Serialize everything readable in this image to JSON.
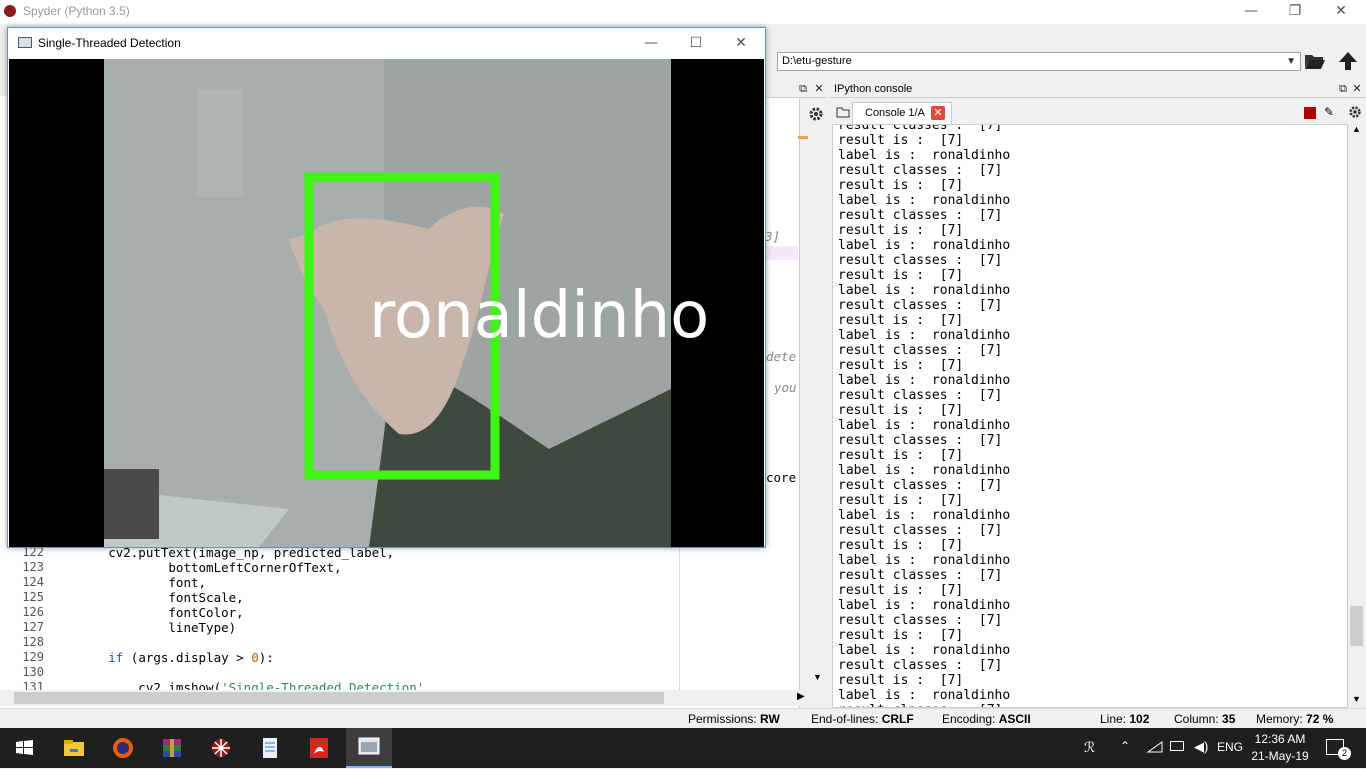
{
  "spyder": {
    "title": "Spyder (Python 3.5)",
    "minimize": "—",
    "restore": "❐",
    "close": "✕"
  },
  "toolbar": {
    "path": "D:\\etu-gesture"
  },
  "console": {
    "header": "IPython console",
    "tab_label": "Console 1/A",
    "lines": [
      "result is :  [7]",
      "label is :  ronaldinho",
      "result classes :  [7]",
      "result is :  [7]",
      "label is :  ronaldinho",
      "result classes :  [7]",
      "result is :  [7]",
      "label is :  ronaldinho",
      "result classes :  [7]",
      "result is :  [7]",
      "label is :  ronaldinho",
      "result classes :  [7]",
      "result is :  [7]",
      "label is :  ronaldinho",
      "result classes :  [7]",
      "result is :  [7]",
      "label is :  ronaldinho",
      "result classes :  [7]",
      "result is :  [7]",
      "label is :  ronaldinho",
      "result classes :  [7]",
      "result is :  [7]",
      "label is :  ronaldinho",
      "result classes :  [7]",
      "result is :  [7]",
      "label is :  ronaldinho",
      "result classes :  [7]",
      "result is :  [7]",
      "label is :  ronaldinho",
      "result classes :  [7]",
      "result is :  [7]",
      "label is :  ronaldinho",
      "result classes :  [7]",
      "result is :  [7]",
      "label is :  ronaldinho",
      "result classes :  [7]",
      "result is :  [7]",
      "label is :  ronaldinho",
      "result classes :  [7]",
      "result is :  [7]",
      "label is :  ronaldinho",
      "result classes :  [7]",
      "result is :  [7]",
      "label is :  ronaldinho",
      "result classes :  [7]",
      "result is :  [7]",
      "label is :  ronaldinho",
      "result classes :  [7]",
      "result is :  [7]",
      "label is :  ronaldinho",
      "result classes :  [7]",
      "result is :  [7]",
      "label is :  ronaldinho",
      "result classes :  [7]",
      "result is :  [7]",
      "label is :  ronaldinho",
      "result classes :  [7]",
      "result is :  [7]",
      "label is :  ronaldinho",
      "result classes :  [7]",
      "result is :  [7]",
      "label is :  ronaldinho",
      "result classes :  [7]",
      "result is :  [7]",
      "label is :  ronaldinho",
      "result classes :  [7]",
      "result is :  [7]",
      "label is :  ronaldinho",
      "result classes :  [7]",
      "result is :  [7]",
      "label is :  ronaldinho",
      "result classes :  [7]",
      "result is :  [7]",
      "label is :  ronaldinho",
      "result classes :  [7]"
    ]
  },
  "editor": {
    "fragments": {
      "f1": "3]",
      "f2": "dete",
      "f3": "you",
      "f4": "core"
    },
    "lines": [
      {
        "no": "122",
        "code": "        cv2.putText(image_np, predicted_label,"
      },
      {
        "no": "123",
        "code": "                bottomLeftCornerOfText,"
      },
      {
        "no": "124",
        "code": "                font,"
      },
      {
        "no": "125",
        "code": "                fontScale,"
      },
      {
        "no": "126",
        "code": "                fontColor,"
      },
      {
        "no": "127",
        "code": "                lineType)"
      },
      {
        "no": "128",
        "code": ""
      },
      {
        "no": "129",
        "code_kw": "if",
        "code": " (args.display > ",
        "code_num": "0",
        "code_tail": "):"
      },
      {
        "no": "130",
        "code": ""
      },
      {
        "no": "131",
        "code": "            cv2.imshow(",
        "code_str": "'Single-Threaded Detection'"
      }
    ]
  },
  "detection": {
    "title": "Single-Threaded Detection",
    "overlay_label": "ronaldinho",
    "box_color": "#3ef515"
  },
  "status": {
    "permissions_label": "Permissions:",
    "permissions_value": "RW",
    "eol_label": "End-of-lines:",
    "eol_value": "CRLF",
    "encoding_label": "Encoding:",
    "encoding_value": "ASCII",
    "line_label": "Line:",
    "line_value": "102",
    "column_label": "Column:",
    "column_value": "35",
    "memory_label": "Memory:",
    "memory_value": "72 %"
  },
  "taskbar": {
    "icons": [
      "windows-start-icon",
      "file-explorer-icon",
      "firefox-icon",
      "winrar-icon",
      "spyder-icon",
      "notepad-icon",
      "acrobat-icon",
      "detection-window-icon"
    ],
    "lang": "ENG",
    "time": "12:36 AM",
    "date": "21-May-19",
    "notifications": "2"
  },
  "colors": {
    "accent": "#1b4fb8",
    "console_close": "#e04a3a",
    "stop_button": "#b00000"
  }
}
